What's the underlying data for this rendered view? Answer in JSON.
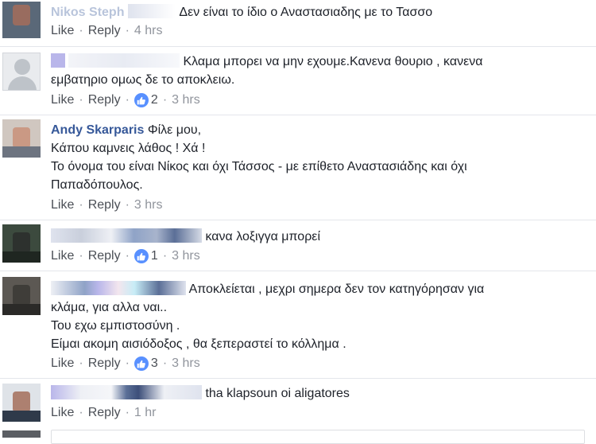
{
  "actions": {
    "like": "Like",
    "reply": "Reply",
    "dot": "·"
  },
  "comments": [
    {
      "author": "Nikos Steph",
      "text": "Δεν είναι το ίδιο ο Αναστασιαδης με το Τασσο",
      "likes": "",
      "time": "4 hrs",
      "avatar": "photo"
    },
    {
      "author": "",
      "text": "Κλαμα μπορει να μην εχουμε.Κανενα θουριο , κανενα\nεμβατηριο ομως δε το αποκλειω.",
      "likes": "2",
      "time": "3 hrs",
      "avatar": "default"
    },
    {
      "author": "Andy Skarparis",
      "text": "Φίλε μου,\nΚάπου καμνεις λάθος ! Χά !\nΤο όνομα του είναι Νίκος και όχι Τάσσος - με επίθετο Αναστασιάδης και όχι\nΠαπαδόπουλος.",
      "likes": "",
      "time": "3 hrs",
      "avatar": "photo"
    },
    {
      "author": "",
      "text": "κανα λοξιγγα μπορεί",
      "likes": "1",
      "time": "3 hrs",
      "avatar": "dark"
    },
    {
      "author": "",
      "text": "Αποκλείεται , μεχρι σημερα δεν τον κατηγόρησαν για\nκλάμα, για αλλα ναι..\nΤου εχω εμπιστοσύνη .\nΕίμαι ακομη αισιόδοξος , θα ξεπεραστεί το κόλλημα .",
      "likes": "3",
      "time": "3 hrs",
      "avatar": "dark"
    },
    {
      "author": "",
      "text": "tha klapsoun oi aligatores",
      "likes": "",
      "time": "1 hr",
      "avatar": "photo"
    }
  ],
  "colors": {
    "author": "#365899",
    "like_badge": "#5890ff",
    "meta": "#90949c"
  }
}
